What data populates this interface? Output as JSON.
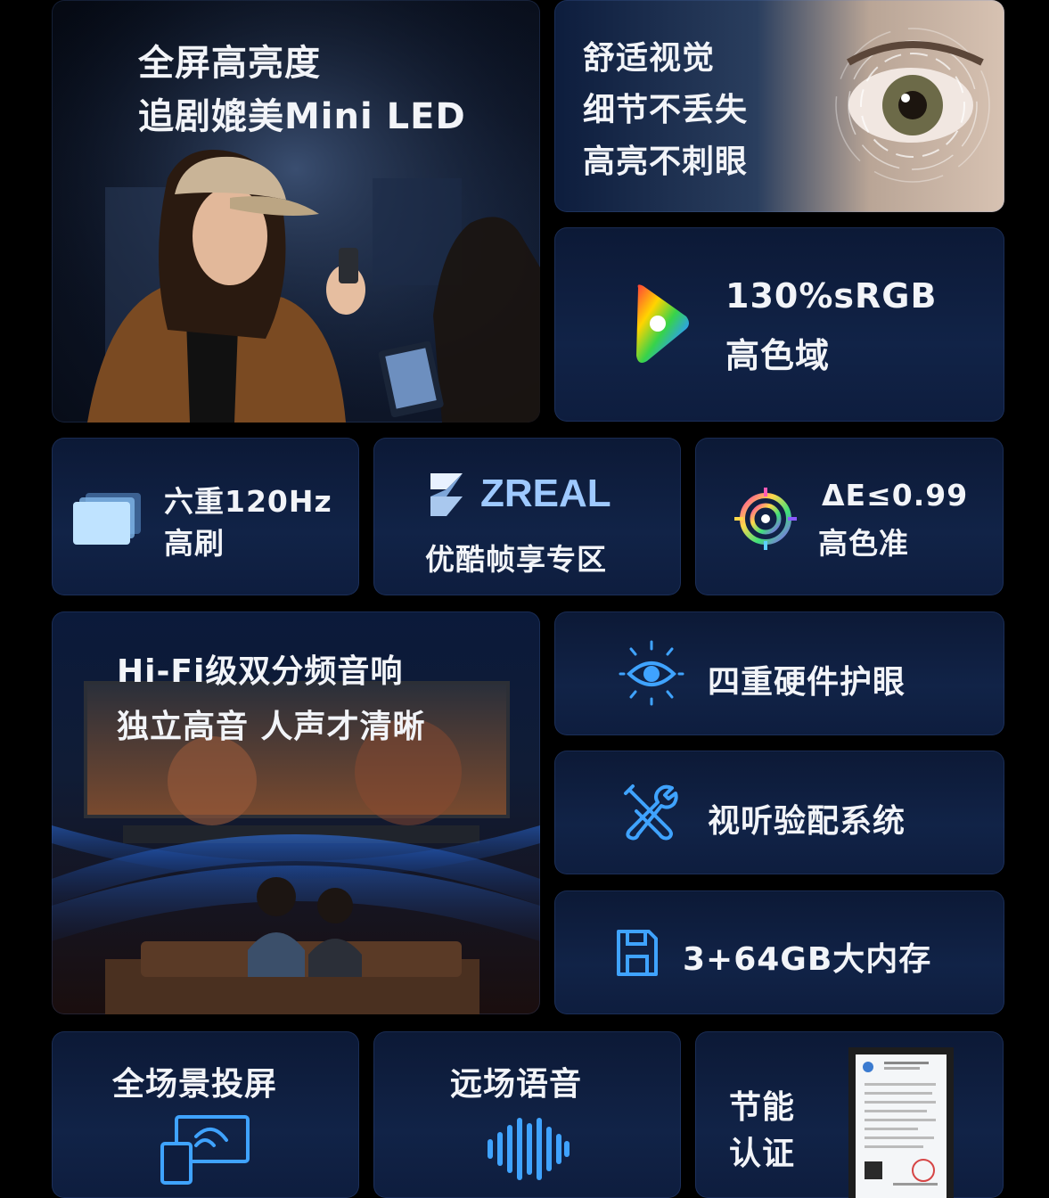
{
  "miniled": {
    "line1": "全屏高亮度",
    "line2": "追剧媲美Mini LED"
  },
  "eye": {
    "line1": "舒适视觉",
    "line2": "细节不丢失",
    "line3": "高亮不刺眼"
  },
  "srgb": {
    "line1": "130%sRGB",
    "line2": "高色域"
  },
  "refresh": {
    "line1": "六重120Hz",
    "line2": "高刷"
  },
  "zreal": {
    "logo": "ZREAL",
    "line2": "优酷帧享专区"
  },
  "delta_e": {
    "line1": "ΔE≤0.99",
    "line2": "高色准"
  },
  "hifi": {
    "line1": "Hi-Fi级双分频音响",
    "line2": "独立高音 人声才清晰"
  },
  "eyecare": {
    "label": "四重硬件护眼"
  },
  "av": {
    "label": "视听验配系统"
  },
  "memory": {
    "label": "3+64GB大内存"
  },
  "cast": {
    "label": "全场景投屏"
  },
  "voice": {
    "label": "远场语音"
  },
  "energy": {
    "line1": "节能",
    "line2": "认证"
  },
  "colors": {
    "accent_blue": "#3fa3ff",
    "icon_light": "#9ec9ff"
  }
}
